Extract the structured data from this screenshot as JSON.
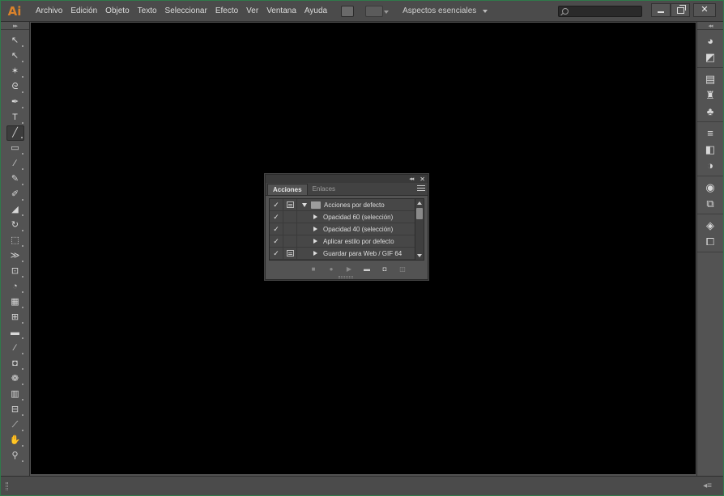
{
  "app": {
    "logo": "Ai",
    "menu": [
      "Archivo",
      "Edición",
      "Objeto",
      "Texto",
      "Seleccionar",
      "Efecto",
      "Ver",
      "Ventana",
      "Ayuda"
    ],
    "workspace": "Aspectos esenciales",
    "search": {
      "value": "",
      "placeholder": ""
    }
  },
  "tools": [
    {
      "name": "selection-tool",
      "glyph": "↖",
      "active": false
    },
    {
      "name": "direct-selection-tool",
      "glyph": "↖",
      "active": false
    },
    {
      "name": "magic-wand-tool",
      "glyph": "✶",
      "active": false
    },
    {
      "name": "lasso-tool",
      "glyph": "ᘓ",
      "active": false
    },
    {
      "name": "pen-tool",
      "glyph": "✒",
      "active": false
    },
    {
      "name": "type-tool",
      "glyph": "T",
      "active": false
    },
    {
      "name": "line-segment-tool",
      "glyph": "╱",
      "active": true
    },
    {
      "name": "rectangle-tool",
      "glyph": "▭",
      "active": false
    },
    {
      "name": "paintbrush-tool",
      "glyph": "∕",
      "active": false
    },
    {
      "name": "pencil-tool",
      "glyph": "✎",
      "active": false
    },
    {
      "name": "blob-brush-tool",
      "glyph": "✐",
      "active": false
    },
    {
      "name": "eraser-tool",
      "glyph": "◢",
      "active": false
    },
    {
      "name": "rotate-tool",
      "glyph": "↻",
      "active": false
    },
    {
      "name": "scale-tool",
      "glyph": "⬚",
      "active": false
    },
    {
      "name": "width-tool",
      "glyph": "≫",
      "active": false
    },
    {
      "name": "free-transform-tool",
      "glyph": "⊡",
      "active": false
    },
    {
      "name": "shape-builder-tool",
      "glyph": "◔",
      "active": false
    },
    {
      "name": "perspective-grid-tool",
      "glyph": "▦",
      "active": false
    },
    {
      "name": "mesh-tool",
      "glyph": "⊞",
      "active": false
    },
    {
      "name": "gradient-tool",
      "glyph": "▬",
      "active": false
    },
    {
      "name": "eyedropper-tool",
      "glyph": "⁄",
      "active": false
    },
    {
      "name": "blend-tool",
      "glyph": "◘",
      "active": false
    },
    {
      "name": "symbol-sprayer-tool",
      "glyph": "❁",
      "active": false
    },
    {
      "name": "column-graph-tool",
      "glyph": "▥",
      "active": false
    },
    {
      "name": "artboard-tool",
      "glyph": "⊟",
      "active": false
    },
    {
      "name": "slice-tool",
      "glyph": "⟋",
      "active": false
    },
    {
      "name": "hand-tool",
      "glyph": "✋",
      "active": false
    },
    {
      "name": "zoom-tool",
      "glyph": "⚲",
      "active": false
    }
  ],
  "dock": [
    [
      {
        "name": "color-panel-icon",
        "glyph": "◕"
      },
      {
        "name": "color-guide-panel-icon",
        "glyph": "◩"
      }
    ],
    [
      {
        "name": "swatches-panel-icon",
        "glyph": "▤"
      },
      {
        "name": "brushes-panel-icon",
        "glyph": "♜"
      },
      {
        "name": "symbols-panel-icon",
        "glyph": "♣"
      }
    ],
    [
      {
        "name": "stroke-panel-icon",
        "glyph": "≡"
      },
      {
        "name": "gradient-panel-icon",
        "glyph": "◧"
      },
      {
        "name": "transparency-panel-icon",
        "glyph": "◑"
      }
    ],
    [
      {
        "name": "appearance-panel-icon",
        "glyph": "◉"
      },
      {
        "name": "graphic-styles-panel-icon",
        "glyph": "⧉"
      }
    ],
    [
      {
        "name": "layers-panel-icon",
        "glyph": "◈"
      },
      {
        "name": "artboards-panel-icon",
        "glyph": "⧠"
      }
    ]
  ],
  "actions_panel": {
    "tabs": [
      {
        "label": "Acciones",
        "active": true
      },
      {
        "label": "Enlaces",
        "active": false
      }
    ],
    "rows": [
      {
        "label": "Acciones por defecto",
        "type": "set",
        "checked": true,
        "dialog": true
      },
      {
        "label": "Opacidad 60 (selección)",
        "type": "action",
        "checked": true,
        "dialog": false
      },
      {
        "label": "Opacidad 40 (selección)",
        "type": "action",
        "checked": true,
        "dialog": false
      },
      {
        "label": "Aplicar estilo por defecto",
        "type": "action",
        "checked": true,
        "dialog": false
      },
      {
        "label": "Guardar para Web / GIF 64",
        "type": "action",
        "checked": true,
        "dialog": true
      }
    ],
    "footer": [
      {
        "name": "stop-recording-icon",
        "glyph": "■",
        "enabled": false
      },
      {
        "name": "begin-recording-icon",
        "glyph": "●",
        "enabled": false
      },
      {
        "name": "play-selection-icon",
        "glyph": "▶",
        "enabled": false
      },
      {
        "name": "new-set-icon",
        "glyph": "▬",
        "enabled": true
      },
      {
        "name": "new-action-icon",
        "glyph": "◘",
        "enabled": true
      },
      {
        "name": "delete-icon",
        "glyph": "◫",
        "enabled": false
      }
    ]
  }
}
